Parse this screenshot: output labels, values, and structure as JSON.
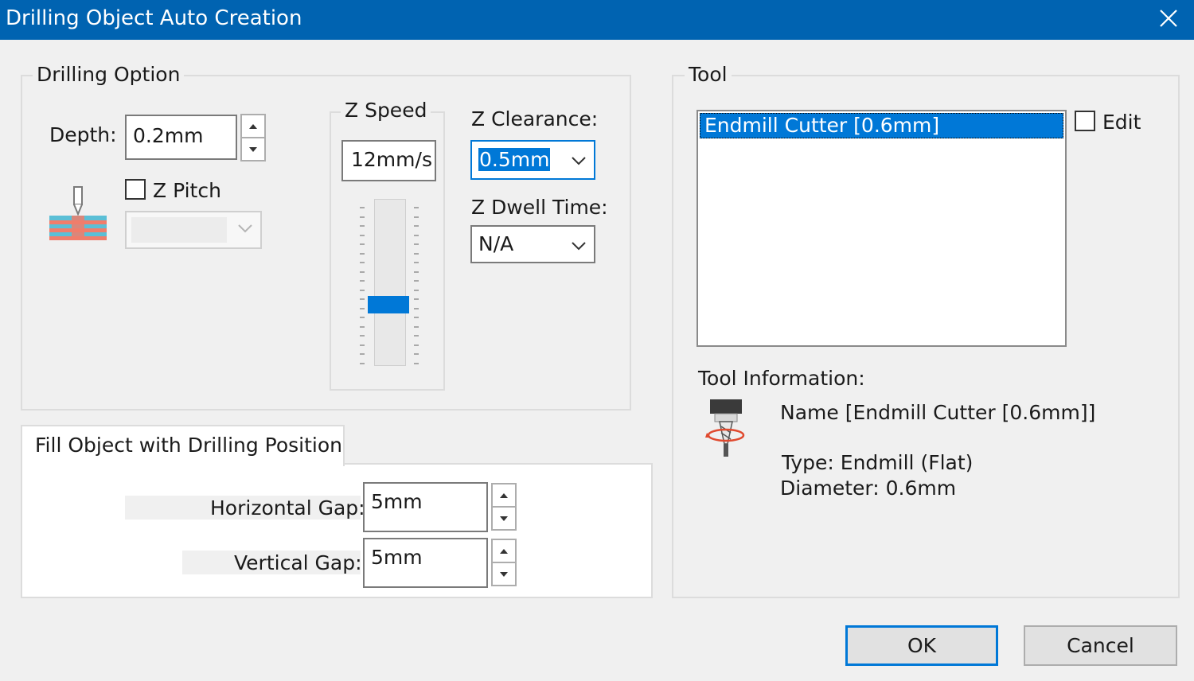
{
  "window": {
    "title": "Drilling Object Auto Creation"
  },
  "drilling_option": {
    "legend": "Drilling Option",
    "depth_label": "Depth:",
    "depth_value": "0.2mm",
    "z_pitch_label": "Z Pitch",
    "z_pitch_checked": false,
    "z_pitch_value": "",
    "z_speed_label": "Z Speed",
    "z_speed_value": "12mm/s",
    "z_speed_slider_fraction": 0.35,
    "z_clearance_label": "Z Clearance:",
    "z_clearance_value": "0.5mm",
    "z_dwell_label": "Z Dwell Time:",
    "z_dwell_value": "N/A"
  },
  "fill": {
    "tab_label": "Fill Object with Drilling Position",
    "horizontal_gap_label": "Horizontal Gap:",
    "horizontal_gap_value": "5mm",
    "vertical_gap_label": "Vertical Gap:",
    "vertical_gap_value": "5mm"
  },
  "tool": {
    "legend": "Tool",
    "items": [
      "Endmill Cutter [0.6mm]"
    ],
    "edit_label": "Edit",
    "edit_checked": false,
    "info_label": "Tool Information:",
    "info_name": "Name [Endmill Cutter [0.6mm]]",
    "info_type": "Type: Endmill (Flat)",
    "info_diameter": "Diameter: 0.6mm"
  },
  "buttons": {
    "ok": "OK",
    "cancel": "Cancel"
  },
  "colors": {
    "titlebar": "#0063b1",
    "selection": "#0078d7",
    "slider_thumb": "#0078d7"
  },
  "icons": {
    "close": "close-icon",
    "drill_layers": "drill-layers-icon",
    "endmill_tool": "endmill-tool-icon",
    "chevron": "chevron-down-icon"
  }
}
